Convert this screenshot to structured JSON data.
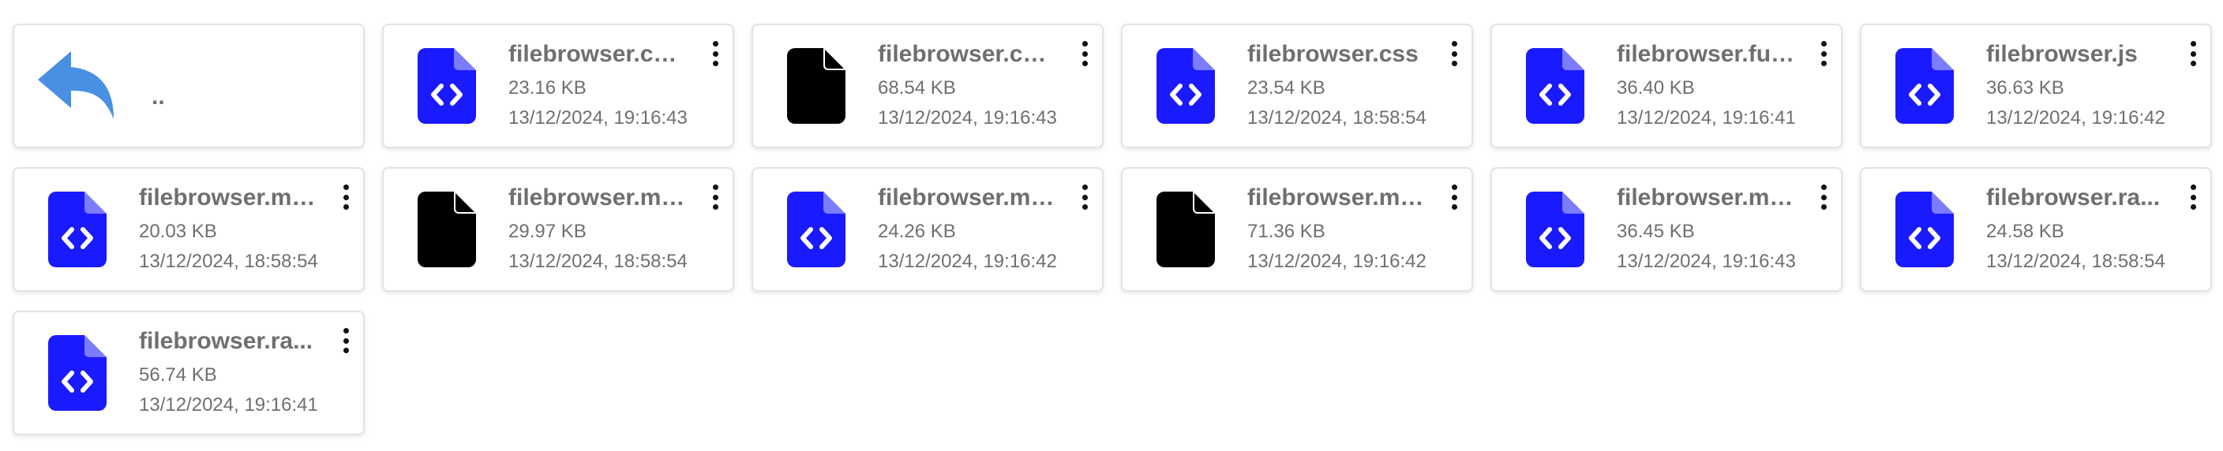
{
  "colors": {
    "code_icon": "#1a1aff",
    "blank_icon": "#000000",
    "back_icon": "#4a90e2",
    "text": "#6f6f6f"
  },
  "up_item": {
    "label": "..",
    "icon": "back-arrow-icon"
  },
  "files": [
    {
      "name": "filebrowser.co...",
      "size": "23.16 KB",
      "modified": "13/12/2024, 19:16:43",
      "icon": "code-file-icon"
    },
    {
      "name": "filebrowser.co...",
      "size": "68.54 KB",
      "modified": "13/12/2024, 19:16:43",
      "icon": "blank-file-icon"
    },
    {
      "name": "filebrowser.css",
      "size": "23.54 KB",
      "modified": "13/12/2024, 18:58:54",
      "icon": "code-file-icon"
    },
    {
      "name": "filebrowser.full...",
      "size": "36.40 KB",
      "modified": "13/12/2024, 19:16:41",
      "icon": "code-file-icon"
    },
    {
      "name": "filebrowser.js",
      "size": "36.63 KB",
      "modified": "13/12/2024, 19:16:42",
      "icon": "code-file-icon"
    },
    {
      "name": "filebrowser.mi...",
      "size": "20.03 KB",
      "modified": "13/12/2024, 18:58:54",
      "icon": "code-file-icon"
    },
    {
      "name": "filebrowser.min...",
      "size": "29.97 KB",
      "modified": "13/12/2024, 18:58:54",
      "icon": "blank-file-icon"
    },
    {
      "name": "filebrowser.mi...",
      "size": "24.26 KB",
      "modified": "13/12/2024, 19:16:42",
      "icon": "code-file-icon"
    },
    {
      "name": "filebrowser.min...",
      "size": "71.36 KB",
      "modified": "13/12/2024, 19:16:42",
      "icon": "blank-file-icon"
    },
    {
      "name": "filebrowser.mo...",
      "size": "36.45 KB",
      "modified": "13/12/2024, 19:16:43",
      "icon": "code-file-icon"
    },
    {
      "name": "filebrowser.ra...",
      "size": "24.58 KB",
      "modified": "13/12/2024, 18:58:54",
      "icon": "code-file-icon"
    },
    {
      "name": "filebrowser.ra...",
      "size": "56.74 KB",
      "modified": "13/12/2024, 19:16:41",
      "icon": "code-file-icon"
    }
  ]
}
